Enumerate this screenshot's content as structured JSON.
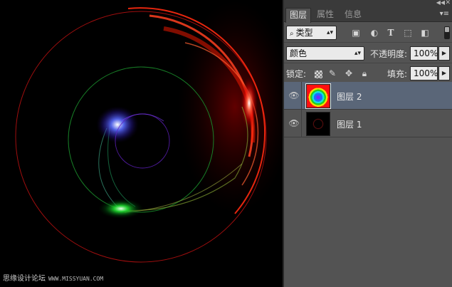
{
  "panel": {
    "tabs": [
      {
        "label": "图层",
        "active": true
      },
      {
        "label": "属性",
        "active": false
      },
      {
        "label": "信息",
        "active": false
      }
    ],
    "filter": {
      "selected": "类型"
    },
    "blend_mode": "颜色",
    "opacity": {
      "label": "不透明度:",
      "value": "100%"
    },
    "lock": {
      "label": "锁定:"
    },
    "fill": {
      "label": "填充:",
      "value": "100%"
    },
    "layers": [
      {
        "name": "图层 2",
        "visible": true,
        "selected": true
      },
      {
        "name": "图层 1",
        "visible": true,
        "selected": false
      }
    ]
  },
  "canvas": {
    "watermark": "思缘设计论坛",
    "watermark_url": "WWW.MISSYUAN.COM"
  },
  "colors": {
    "panel_bg": "#535353",
    "selected_layer": "#5a6678",
    "canvas_bg": "#000000"
  }
}
